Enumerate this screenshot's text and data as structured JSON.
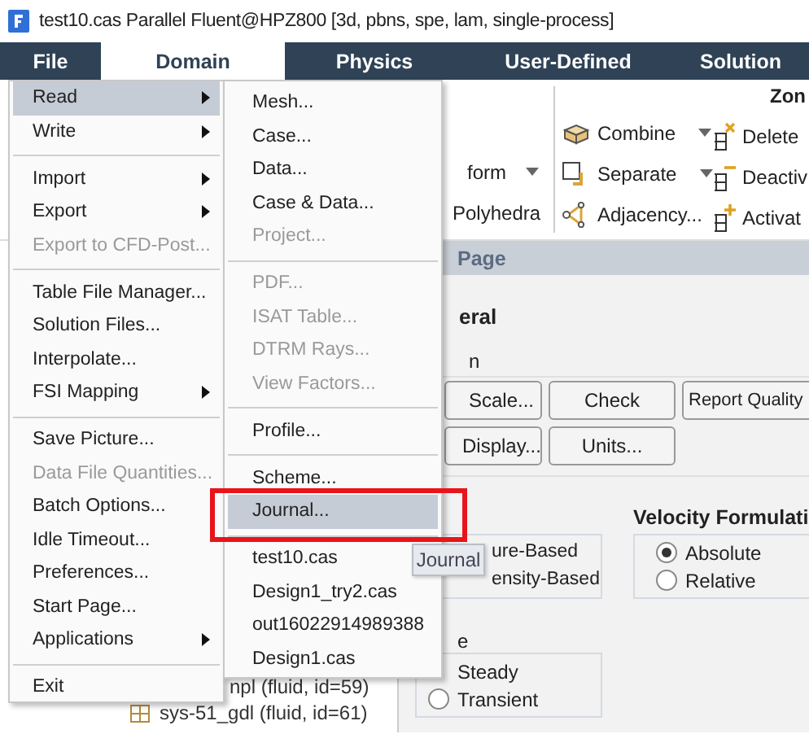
{
  "window": {
    "title": "test10.cas Parallel Fluent@HPZ800  [3d, pbns, spe, lam, single-process]"
  },
  "menubar": [
    {
      "label": "File",
      "selected": false
    },
    {
      "label": "Domain",
      "selected": true
    },
    {
      "label": "Physics",
      "selected": false
    },
    {
      "label": "User-Defined",
      "selected": false
    },
    {
      "label": "Solution",
      "selected": false
    }
  ],
  "ribbon": {
    "column_1": [
      {
        "label": "form",
        "dropdown": true
      },
      {
        "label": "Polyhedra",
        "dropdown": false
      }
    ],
    "zone_tools": [
      {
        "label": "Combine",
        "dropdown": true
      },
      {
        "label": "Separate",
        "dropdown": true
      },
      {
        "label": "Adjacency...",
        "dropdown": false
      }
    ],
    "zone_group": {
      "title": "Zon",
      "items": [
        "Delete",
        "Deactiv",
        "Activat"
      ]
    }
  },
  "task_page": {
    "header": "Page",
    "section_title": "eral",
    "mesh_label": "n",
    "mesh_buttons": [
      "Scale...",
      "Check",
      "Report Quality",
      "Display...",
      "Units..."
    ],
    "type_options": [
      "ure-Based",
      "ensity-Based"
    ],
    "velocity_formulation": {
      "title": "Velocity Formulati",
      "options": [
        {
          "label": "Absolute",
          "selected": true
        },
        {
          "label": "Relative",
          "selected": false
        }
      ]
    },
    "time": {
      "label": "e",
      "options": [
        {
          "label": "Steady"
        },
        {
          "label": "Transient",
          "selected": false
        }
      ]
    }
  },
  "tree_items": [
    {
      "label": "npl (fluid, id=59)",
      "kind": "text"
    },
    {
      "label": "sys-51_gdl (fluid, id=61)",
      "kind": "zone"
    }
  ],
  "file_menu": {
    "items": [
      {
        "kind": "item",
        "label": "Read",
        "selected": true,
        "disabled": false,
        "submenu": true
      },
      {
        "kind": "item",
        "label": "Write",
        "selected": false,
        "disabled": false,
        "submenu": true
      },
      {
        "kind": "separator"
      },
      {
        "kind": "item",
        "label": "Import",
        "selected": false,
        "disabled": false,
        "submenu": true
      },
      {
        "kind": "item",
        "label": "Export",
        "selected": false,
        "disabled": false,
        "submenu": true
      },
      {
        "kind": "item",
        "label": "Export to CFD-Post...",
        "selected": false,
        "disabled": true,
        "submenu": false
      },
      {
        "kind": "separator"
      },
      {
        "kind": "item",
        "label": "Table File Manager...",
        "selected": false,
        "disabled": false,
        "submenu": false
      },
      {
        "kind": "item",
        "label": "Solution Files...",
        "selected": false,
        "disabled": false,
        "submenu": false
      },
      {
        "kind": "item",
        "label": "Interpolate...",
        "selected": false,
        "disabled": false,
        "submenu": false
      },
      {
        "kind": "item",
        "label": "FSI Mapping",
        "selected": false,
        "disabled": false,
        "submenu": true
      },
      {
        "kind": "separator"
      },
      {
        "kind": "item",
        "label": "Save Picture...",
        "selected": false,
        "disabled": false,
        "submenu": false
      },
      {
        "kind": "item",
        "label": "Data File Quantities...",
        "selected": false,
        "disabled": true,
        "submenu": false
      },
      {
        "kind": "item",
        "label": "Batch Options...",
        "selected": false,
        "disabled": false,
        "submenu": false
      },
      {
        "kind": "item",
        "label": "Idle Timeout...",
        "selected": false,
        "disabled": false,
        "submenu": false
      },
      {
        "kind": "item",
        "label": "Preferences...",
        "selected": false,
        "disabled": false,
        "submenu": false
      },
      {
        "kind": "item",
        "label": "Start Page...",
        "selected": false,
        "disabled": false,
        "submenu": false
      },
      {
        "kind": "item",
        "label": "Applications",
        "selected": false,
        "disabled": false,
        "submenu": true
      },
      {
        "kind": "separator"
      },
      {
        "kind": "item",
        "label": "Exit",
        "selected": false,
        "disabled": false,
        "submenu": false
      }
    ]
  },
  "read_submenu": {
    "items": [
      {
        "kind": "item",
        "label": "Mesh...",
        "selected": false,
        "disabled": false
      },
      {
        "kind": "item",
        "label": "Case...",
        "selected": false,
        "disabled": false
      },
      {
        "kind": "item",
        "label": "Data...",
        "selected": false,
        "disabled": false
      },
      {
        "kind": "item",
        "label": "Case & Data...",
        "selected": false,
        "disabled": false
      },
      {
        "kind": "item",
        "label": "Project...",
        "selected": false,
        "disabled": true
      },
      {
        "kind": "separator"
      },
      {
        "kind": "item",
        "label": "PDF...",
        "selected": false,
        "disabled": true
      },
      {
        "kind": "item",
        "label": "ISAT Table...",
        "selected": false,
        "disabled": true
      },
      {
        "kind": "item",
        "label": "DTRM Rays...",
        "selected": false,
        "disabled": true
      },
      {
        "kind": "item",
        "label": "View Factors...",
        "selected": false,
        "disabled": true
      },
      {
        "kind": "separator"
      },
      {
        "kind": "item",
        "label": "Profile...",
        "selected": false,
        "disabled": false
      },
      {
        "kind": "separator"
      },
      {
        "kind": "item",
        "label": "Scheme...",
        "selected": false,
        "disabled": false
      },
      {
        "kind": "item",
        "label": "Journal...",
        "selected": true,
        "disabled": false
      },
      {
        "kind": "separator"
      },
      {
        "kind": "item",
        "label": "test10.cas",
        "selected": false,
        "disabled": false
      },
      {
        "kind": "item",
        "label": "Design1_try2.cas",
        "selected": false,
        "disabled": false
      },
      {
        "kind": "item",
        "label": "out16022914989388",
        "selected": false,
        "disabled": false
      },
      {
        "kind": "item",
        "label": "Design1.cas",
        "selected": false,
        "disabled": false
      }
    ]
  },
  "tooltip": {
    "text": "Journal"
  }
}
